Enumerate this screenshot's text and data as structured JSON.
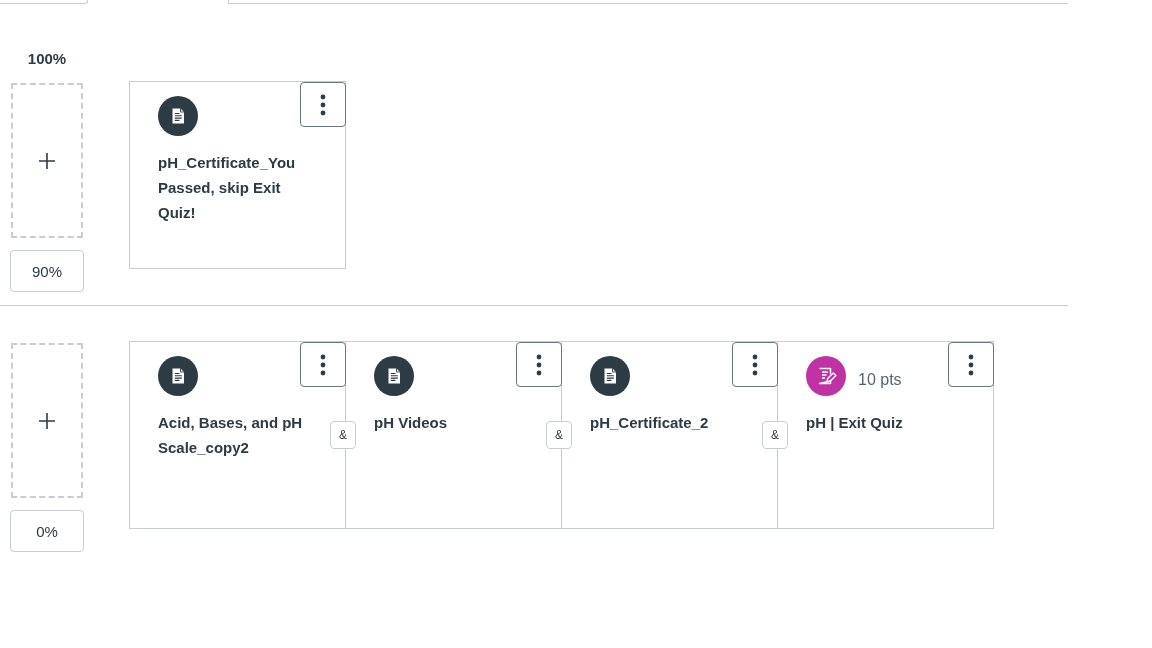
{
  "ranges": [
    {
      "upper_score": "100%",
      "lower_score": "90%",
      "items": [
        {
          "kind": "page",
          "title": "pH_Certificate_You Passed, skip Exit Quiz!"
        }
      ]
    },
    {
      "lower_score": "0%",
      "items": [
        {
          "kind": "page",
          "title": "Acid, Bases, and pH Scale_copy2",
          "connector": "&"
        },
        {
          "kind": "page",
          "title": "pH Videos",
          "connector": "&"
        },
        {
          "kind": "page",
          "title": "pH_Certificate_2",
          "connector": "&"
        },
        {
          "kind": "quiz",
          "title": "pH | Exit Quiz",
          "points": "10 pts"
        }
      ]
    }
  ]
}
